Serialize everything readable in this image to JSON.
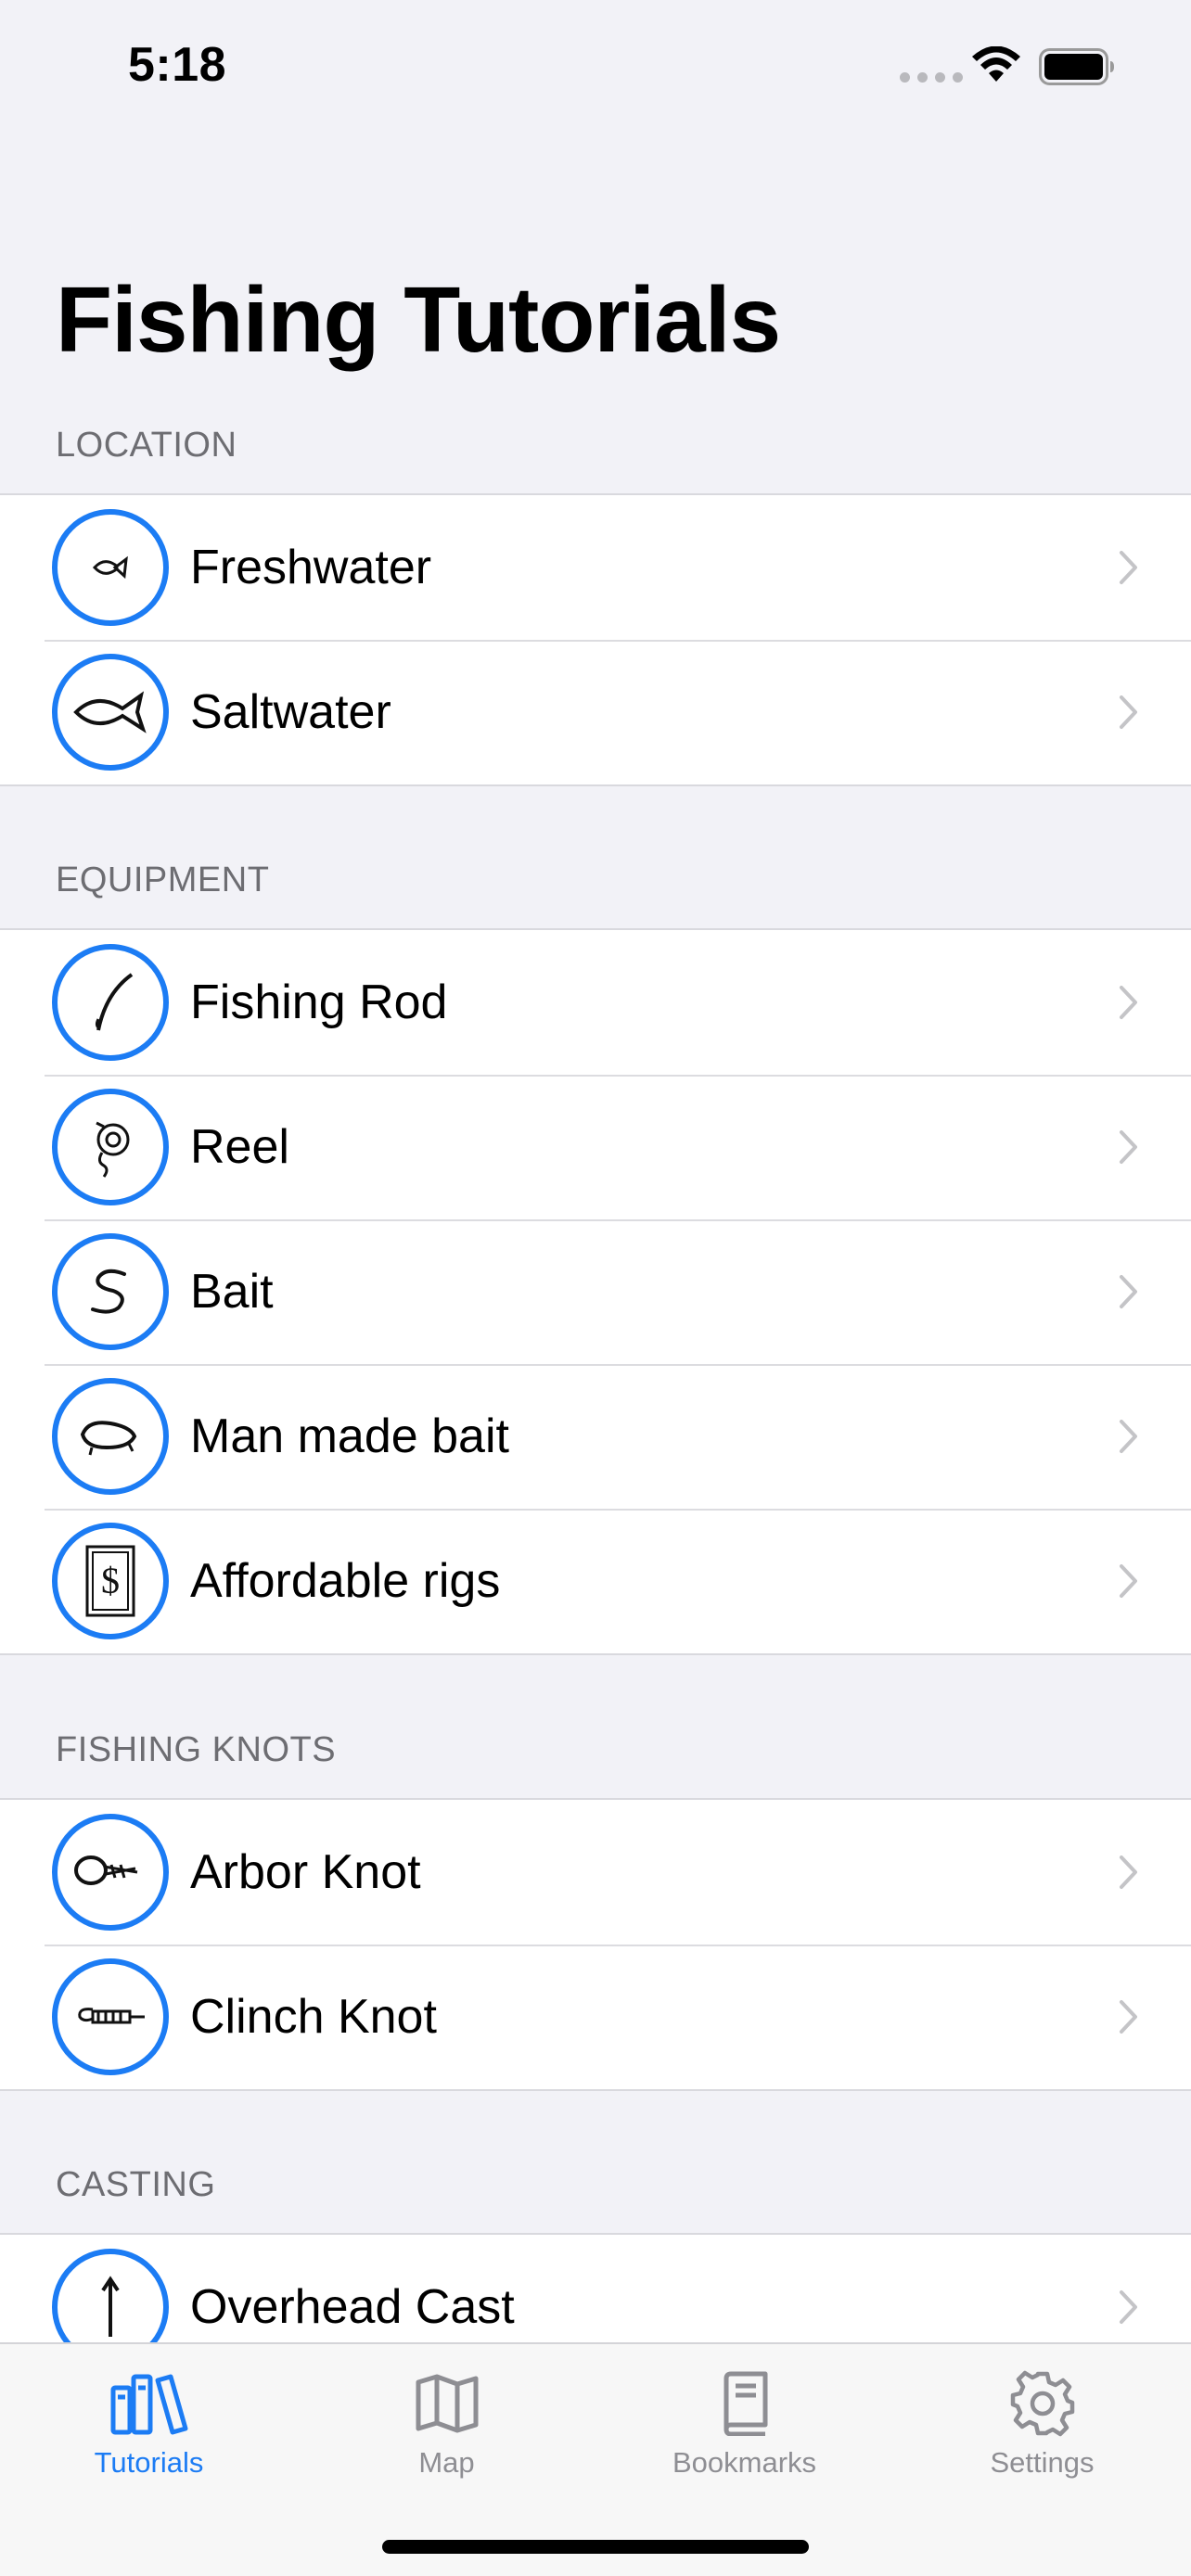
{
  "status_bar": {
    "time": "5:18"
  },
  "page_title": "Fishing Tutorials",
  "sections": [
    {
      "header": "LOCATION",
      "items": [
        {
          "label": "Freshwater",
          "icon": "small-fish-sketch-icon"
        },
        {
          "label": "Saltwater",
          "icon": "fish-sketch-icon"
        }
      ]
    },
    {
      "header": "EQUIPMENT",
      "items": [
        {
          "label": "Fishing Rod",
          "icon": "fishing-rod-sketch-icon"
        },
        {
          "label": "Reel",
          "icon": "reel-sketch-icon"
        },
        {
          "label": "Bait",
          "icon": "worm-sketch-icon"
        },
        {
          "label": "Man made bait",
          "icon": "lure-sketch-icon"
        },
        {
          "label": "Affordable rigs",
          "icon": "dollar-bill-icon"
        }
      ]
    },
    {
      "header": "FISHING KNOTS",
      "items": [
        {
          "label": "Arbor Knot",
          "icon": "arbor-knot-sketch-icon"
        },
        {
          "label": "Clinch Knot",
          "icon": "clinch-knot-sketch-icon"
        }
      ]
    },
    {
      "header": "CASTING",
      "items": [
        {
          "label": "Overhead Cast",
          "icon": "arrow-up-sketch-icon"
        }
      ]
    }
  ],
  "tab_bar": {
    "active": "Tutorials",
    "tabs": [
      {
        "label": "Tutorials",
        "icon": "books-icon"
      },
      {
        "label": "Map",
        "icon": "map-icon"
      },
      {
        "label": "Bookmarks",
        "icon": "book-icon"
      },
      {
        "label": "Settings",
        "icon": "gear-icon"
      }
    ]
  },
  "colors": {
    "accent": "#1c7cf4",
    "background": "#f2f2f7",
    "inactive": "#8e8e93"
  }
}
